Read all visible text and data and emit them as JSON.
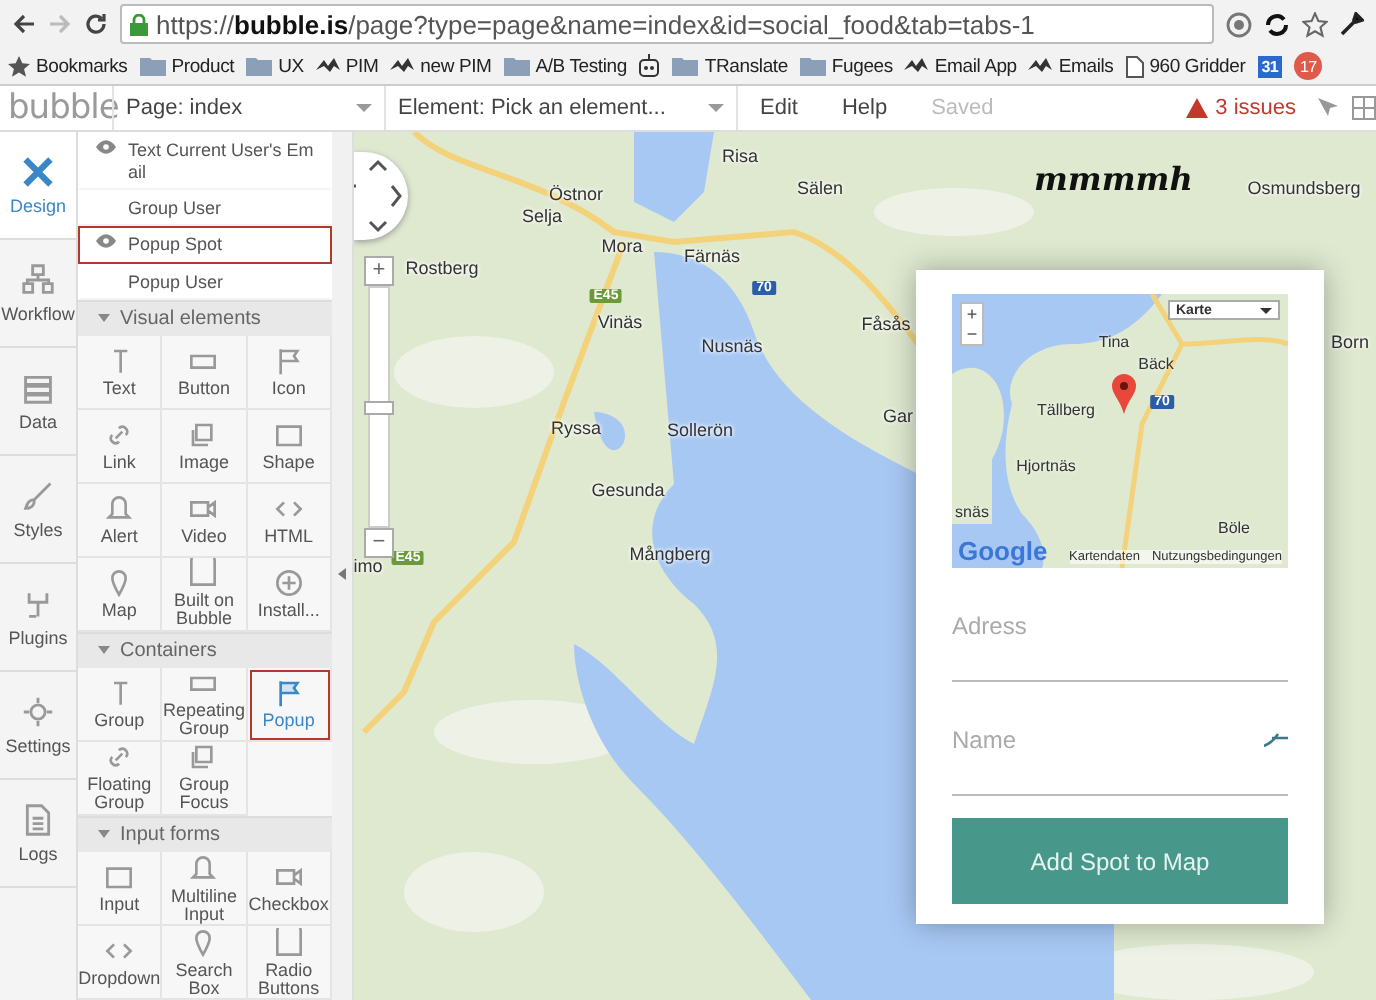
{
  "browser": {
    "url": "https://**bubble.is**/page?type=page&name=index&id=social_food&tab=tabs-1",
    "bookmarks": [
      {
        "label": "Bookmarks",
        "kind": "star"
      },
      {
        "label": "Product",
        "kind": "folder"
      },
      {
        "label": "UX",
        "kind": "folder"
      },
      {
        "label": "PIM",
        "kind": "site"
      },
      {
        "label": "new PIM",
        "kind": "site"
      },
      {
        "label": "A/B Testing",
        "kind": "folder"
      },
      {
        "kind": "robot"
      },
      {
        "label": "TRanslate",
        "kind": "folder"
      },
      {
        "label": "Fugees",
        "kind": "folder"
      },
      {
        "label": "Email App",
        "kind": "site"
      },
      {
        "label": "Emails",
        "kind": "site"
      },
      {
        "label": "960 Gridder",
        "kind": "page"
      },
      {
        "label": "31",
        "kind": "calendar"
      },
      {
        "label": "17",
        "kind": "badge"
      }
    ]
  },
  "header": {
    "logo": "bubble",
    "page_selector": "Page: index",
    "element_selector": "Element: Pick an element...",
    "menu": [
      {
        "label": "Edit",
        "disabled": false
      },
      {
        "label": "Help",
        "disabled": false
      },
      {
        "label": "Saved",
        "disabled": true
      }
    ],
    "issues": "3 issues"
  },
  "sidebar": {
    "tabs": [
      {
        "label": "Design",
        "selected": true
      },
      {
        "label": "Workflow",
        "selected": false
      },
      {
        "label": "Data",
        "selected": false
      },
      {
        "label": "Styles",
        "selected": false
      },
      {
        "label": "Plugins",
        "selected": false
      },
      {
        "label": "Settings",
        "selected": false
      },
      {
        "label": "Logs",
        "selected": false
      }
    ]
  },
  "layers": [
    {
      "label": "Text Current User's Email",
      "eye": true,
      "selected": false
    },
    {
      "label": "Group User",
      "eye": false,
      "selected": false
    },
    {
      "label": "Popup Spot",
      "eye": true,
      "selected": true
    },
    {
      "label": "Popup User",
      "eye": false,
      "selected": false
    }
  ],
  "palette": [
    {
      "title": "Visual elements",
      "expanded": true,
      "items": [
        {
          "label": "Text",
          "selected": false
        },
        {
          "label": "Button",
          "selected": false
        },
        {
          "label": "Icon",
          "selected": false
        },
        {
          "label": "Link",
          "selected": false
        },
        {
          "label": "Image",
          "selected": false
        },
        {
          "label": "Shape",
          "selected": false
        },
        {
          "label": "Alert",
          "selected": false
        },
        {
          "label": "Video",
          "selected": false
        },
        {
          "label": "HTML",
          "selected": false
        },
        {
          "label": "Map",
          "selected": false
        },
        {
          "label": "Built on Bubble",
          "selected": false
        },
        {
          "label": "Install...",
          "selected": false
        }
      ]
    },
    {
      "title": "Containers",
      "expanded": true,
      "items": [
        {
          "label": "Group",
          "selected": false
        },
        {
          "label": "Repeating Group",
          "selected": false
        },
        {
          "label": "Popup",
          "selected": true
        },
        {
          "label": "Floating Group",
          "selected": false
        },
        {
          "label": "Group Focus",
          "selected": false
        }
      ]
    },
    {
      "title": "Input forms",
      "expanded": true,
      "items": [
        {
          "label": "Input",
          "selected": false
        },
        {
          "label": "Multiline Input",
          "selected": false
        },
        {
          "label": "Checkbox",
          "selected": false
        },
        {
          "label": "Dropdown",
          "selected": false
        },
        {
          "label": "Search Box",
          "selected": false
        },
        {
          "label": "Radio Buttons",
          "selected": false
        }
      ]
    }
  ],
  "map": {
    "labels": [
      "Risa",
      "Östnor",
      "Sälen",
      "Osmundsberg",
      "Selja",
      "Rostberg",
      "Mora",
      "Färnäs",
      "Vinäs",
      "Nusnäs",
      "Fåsås",
      "Born",
      "Ryssa",
      "Sollerön",
      "Gar",
      "Gesunda",
      "imo",
      "Mångberg"
    ],
    "zoom": {
      "zoom_in": "+",
      "zoom_out": "−",
      "level": 0.5
    },
    "road_signs": [
      "E45",
      "70",
      "E45"
    ],
    "annotation": "mmmmh"
  },
  "popup": {
    "map": {
      "type_selector": "Karte",
      "labels": [
        "Tina",
        "Bäck",
        "Tällberg",
        "Hjortnäs",
        "snäs",
        "Böle"
      ],
      "road_sign": "70",
      "zoom_in": "+",
      "zoom_out": "−",
      "logo": "Google",
      "footer": [
        "Kartendaten",
        "Nutzungsbedingungen"
      ]
    },
    "fields": [
      {
        "placeholder": "Adress"
      },
      {
        "placeholder": "Name"
      }
    ],
    "button": "Add Spot to Map"
  }
}
